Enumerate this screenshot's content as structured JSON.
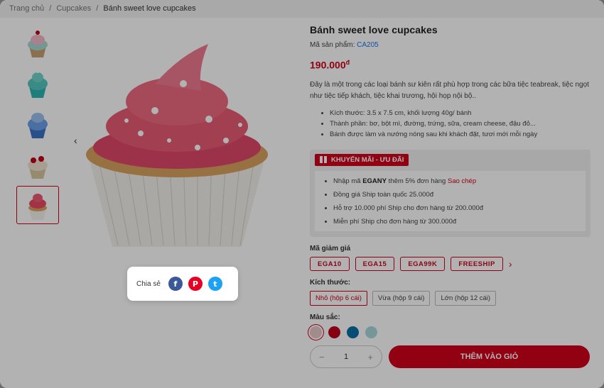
{
  "breadcrumb": {
    "home": "Trang chủ",
    "category": "Cupcakes",
    "current": "Bánh sweet love cupcakes"
  },
  "product": {
    "title": "Bánh sweet love cupcakes",
    "sku_label": "Mã sản phẩm:",
    "sku": "CA205",
    "price": "190.000",
    "currency": "đ",
    "description": "Đây là một trong các loại bánh sư kiên rất phù hợp trong các bữa tiệc teabreak, tiệc ngọt như tiệc tiếp khách, tiệc khai trương, hội họp nội bộ..",
    "bullets": [
      "Kích thước: 3.5 x 7.5 cm, khối lượng 40g/ bánh",
      "Thành phần: bơ, bột mì, đường, trứng, sữa, cream cheese, đậu đỏ...",
      "Bánh được làm và nướng nóng sau khi khách đặt, tươi mới mỗi ngày"
    ]
  },
  "promo": {
    "tag": "KHUYẾN MÃI - ƯU ĐÃI",
    "line1_pre": "Nhập mã",
    "line1_code": "EGANY",
    "line1_mid": "thêm 5% đơn hàng",
    "line1_copy": "Sao chép",
    "line2": "Đồng giá Ship toàn quốc 25.000đ",
    "line3": "Hỗ trợ 10.000 phí Ship cho đơn hàng từ 200.000đ",
    "line4": "Miễn phí Ship cho đơn hàng từ 300.000đ"
  },
  "coupons": {
    "label": "Mã giảm giá",
    "codes": [
      "EGA10",
      "EGA15",
      "EGA99K",
      "FREESHIP"
    ]
  },
  "sizes": {
    "label": "Kích thước:",
    "options": [
      "Nhỏ (hộp 6 cái)",
      "Vừa (hộp 9 cái)",
      "Lớn (hộp 12 cái)"
    ],
    "selected": "Nhỏ (hộp 6 cái)"
  },
  "colors": {
    "label": "Màu sắc:",
    "swatches": [
      "#e8c7c7",
      "#c0001a",
      "#0a6fa8",
      "#a9d9dc"
    ]
  },
  "cart": {
    "qty": "1",
    "minus": "−",
    "plus": "+",
    "add_label": "THÊM VÀO GIỎ"
  },
  "share": {
    "label": "Chia sẻ",
    "icons": [
      "facebook-icon",
      "pinterest-icon",
      "twitter-icon"
    ]
  },
  "colors_theme": {
    "accent": "#d0021b",
    "link": "#1a73e8"
  }
}
